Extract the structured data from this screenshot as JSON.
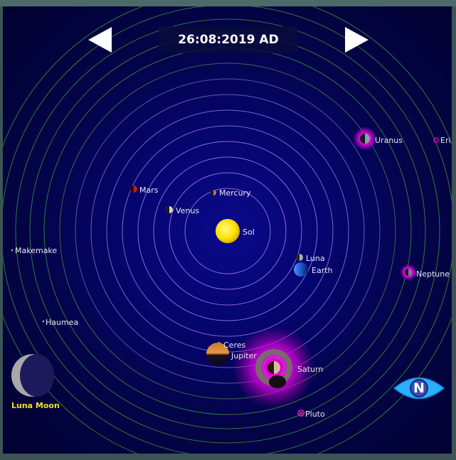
{
  "header": {
    "date": "26:08:2019 AD"
  },
  "bodies": {
    "sol": "Sol",
    "mercury": "Mercury",
    "venus": "Venus",
    "mars": "Mars",
    "earth": "Earth",
    "luna": "Luna",
    "ceres": "Ceres",
    "jupiter": "Jupiter",
    "saturn": "Saturn",
    "uranus": "Uranus",
    "neptune": "Neptune",
    "pluto": "Pluto",
    "makemake": "Makemake",
    "haumea": "Haumea",
    "eris": "Eri"
  },
  "moon_phase": {
    "label": "Luna Moon"
  },
  "badge": {
    "letter": "N"
  },
  "colors": {
    "background": "#03034a",
    "orbit_inner": "#8a6ad8",
    "orbit_outer": "#2f7a3a",
    "glow": "#ff00ff",
    "label": "#e8e8f0",
    "moon_label": "#f0e020",
    "sun": "#ffe000"
  }
}
